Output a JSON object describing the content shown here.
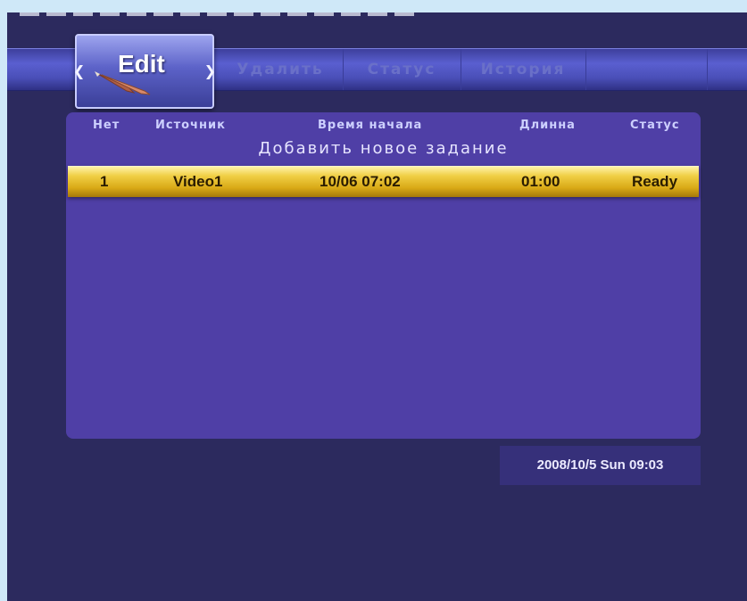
{
  "tabs": {
    "active": {
      "label": "Edit"
    },
    "items": [
      {
        "label": "Удалить"
      },
      {
        "label": "Статус"
      },
      {
        "label": "История"
      }
    ]
  },
  "table": {
    "headers": [
      "Нет",
      "Источник",
      "Время начала",
      "Длинна",
      "Статус"
    ],
    "add_new": "Добавить новое задание",
    "rows": [
      {
        "no": "1",
        "source": "Video1",
        "start_time": "10/06 07:02",
        "length": "01:00",
        "status": "Ready"
      }
    ]
  },
  "clock": "2008/10/5 Sun 09:03",
  "colors": {
    "background": "#2c2a5e",
    "panel": "#4f3fa6",
    "highlight": "#f0cf45",
    "tabbar": "#5a5fd0"
  },
  "icons": {
    "edit_tab": "pen-icon"
  }
}
